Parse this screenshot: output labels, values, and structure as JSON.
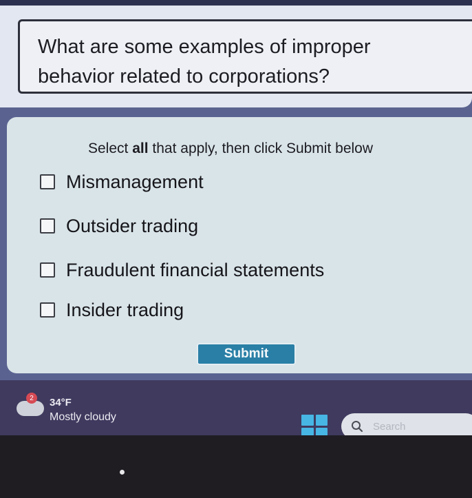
{
  "question": {
    "text": "What are some examples of improper behavior related to corporations?"
  },
  "answers": {
    "instruction_pre": "Select ",
    "instruction_bold": "all",
    "instruction_post": " that apply, then click Submit below",
    "options": [
      {
        "label": "Mismanagement",
        "checked": false
      },
      {
        "label": "Outsider trading",
        "checked": false
      },
      {
        "label": "Fraudulent financial statements",
        "checked": false
      },
      {
        "label": "Insider trading",
        "checked": false
      }
    ],
    "submit_label": "Submit"
  },
  "taskbar": {
    "weather_badge": "2",
    "weather_temp": "34°F",
    "weather_condition": "Mostly cloudy",
    "weather_icon": "cloud-icon",
    "start_icon": "windows-start-icon",
    "search_icon": "search-icon",
    "search_placeholder": "Search"
  },
  "colors": {
    "submit_button": "#2a7fa6",
    "start_icon": "#47b6e4",
    "taskbar": "#3f3a5e"
  }
}
